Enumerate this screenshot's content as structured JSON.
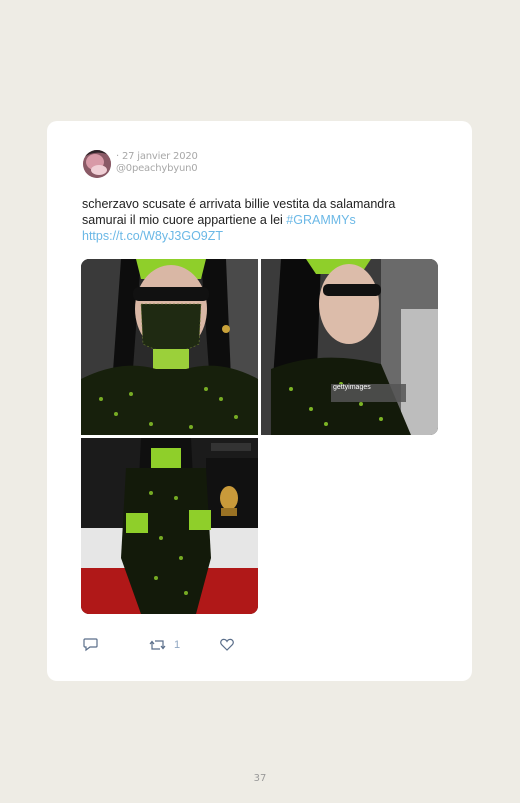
{
  "tweet": {
    "date": "· 27 janvier 2020",
    "handle": "@0peachybyun0",
    "text_main": "scherzavo scusate é arrivata billie vestita da salamandra samurai il mio cuore appartiene a lei ",
    "hashtag": "#GRAMMYs",
    "link": "https://t.co/W8yJ3GO9ZT",
    "retweet_count": "1",
    "photo_watermark": "gettyimages"
  },
  "page": {
    "number": "37"
  },
  "icons": [
    "reply-icon",
    "retweet-icon",
    "like-icon"
  ],
  "colors": {
    "link": "#6bb8e6",
    "meta": "#a8a8a8",
    "background": "#eeece5"
  }
}
